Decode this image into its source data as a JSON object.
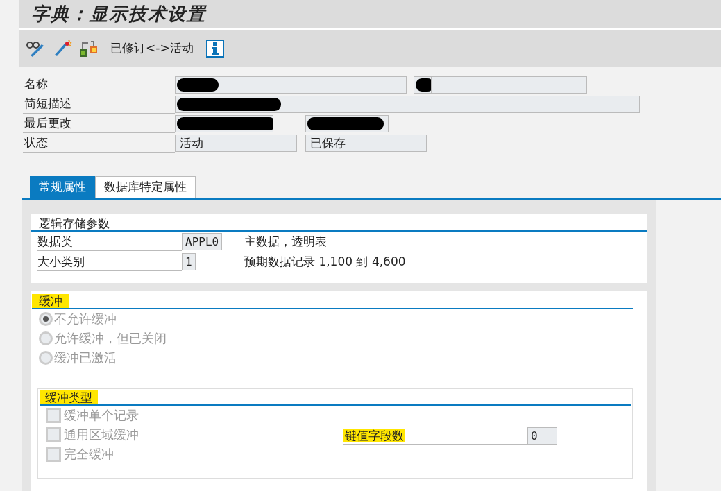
{
  "title": "字典：显示技术设置",
  "toolbar": {
    "status_text": "已修订<->活动"
  },
  "header_rows": [
    {
      "label": "名称",
      "fields": [
        {
          "redacted": true
        },
        {
          "redacted": true
        },
        {
          "redacted": false
        }
      ]
    },
    {
      "label": "简短描述",
      "fields": [
        {
          "redacted": true
        }
      ]
    },
    {
      "label": "最后更改",
      "fields": [
        {
          "redacted": true
        },
        {
          "redacted": true
        }
      ]
    },
    {
      "label": "状态",
      "fields": [
        {
          "value": "活动",
          "redacted": false
        },
        {
          "value": "已保存",
          "redacted": false
        }
      ]
    }
  ],
  "tabs": [
    {
      "label": "常规属性",
      "selected": true
    },
    {
      "label": "数据库特定属性",
      "selected": false
    }
  ],
  "storage": {
    "title": "逻辑存储参数",
    "rows": [
      {
        "label": "数据类",
        "value": "APPL0",
        "description": "主数据，透明表"
      },
      {
        "label": "大小类别",
        "value": "1",
        "description": "预期数据记录 1,100 到 4,600"
      }
    ]
  },
  "buffering": {
    "title": "缓冲",
    "highlighted": true,
    "options": [
      {
        "label": "不允许缓冲",
        "selected": true,
        "disabled": true
      },
      {
        "label": "允许缓冲，但已关闭",
        "selected": false,
        "disabled": true
      },
      {
        "label": "缓冲已激活",
        "selected": false,
        "disabled": true
      }
    ],
    "type_group": {
      "title": "缓冲类型",
      "highlighted": true,
      "options": [
        {
          "label": "缓冲单个记录",
          "checked": false,
          "disabled": true
        },
        {
          "label": "通用区域缓冲",
          "checked": false,
          "disabled": true
        },
        {
          "label": "完全缓冲",
          "checked": false,
          "disabled": true
        }
      ],
      "key_fields": {
        "label": "键值字段数",
        "highlighted": true,
        "value": "0"
      }
    }
  }
}
